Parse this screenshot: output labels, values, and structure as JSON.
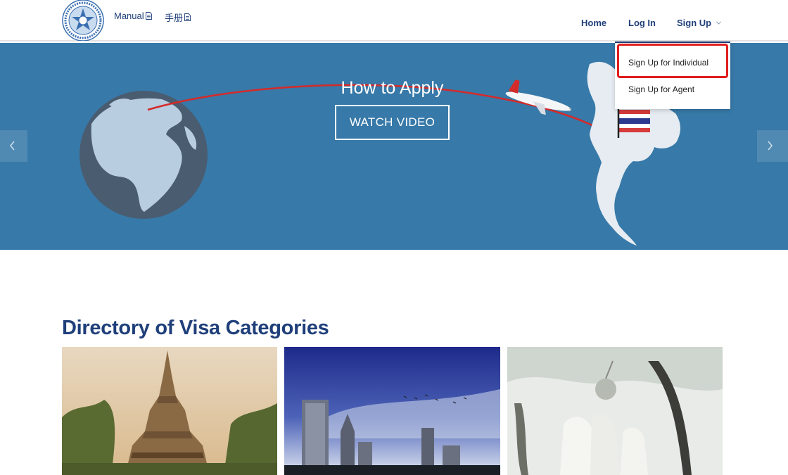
{
  "header": {
    "links": [
      {
        "label": "Manual"
      },
      {
        "label": "手册"
      }
    ],
    "nav": {
      "home": "Home",
      "login": "Log In",
      "signup": "Sign Up"
    }
  },
  "hero": {
    "title": "How to Apply",
    "button": "WATCH VIDEO"
  },
  "dropdown": {
    "items": [
      {
        "label": "Sign Up for Individual"
      },
      {
        "label": "Sign Up for Agent"
      }
    ]
  },
  "directory": {
    "title": "Directory of Visa Categories"
  },
  "colors": {
    "brand": "#1f3f7a",
    "hero_bg": "#3779a8",
    "highlight": "#e01e1e"
  },
  "icons": [
    "document-icon",
    "chevron-down-icon",
    "chevron-left-icon",
    "chevron-right-icon",
    "seal-logo"
  ]
}
